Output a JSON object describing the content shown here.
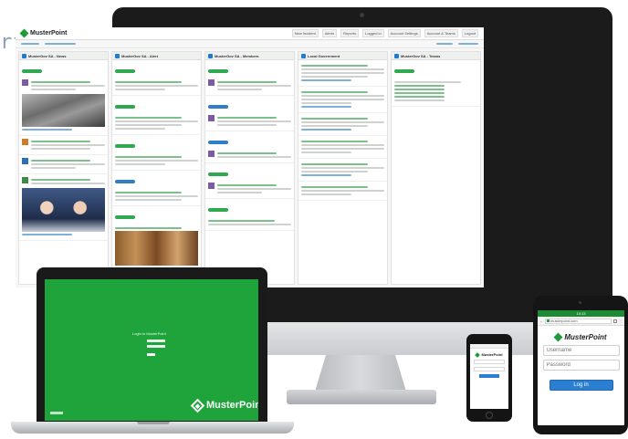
{
  "side_text": "rt",
  "brand": {
    "name": "MusterPoint",
    "accent": "#1f9b3a",
    "link_color": "#2b7fd0"
  },
  "desktop": {
    "logo_text": "MusterPoint",
    "nav": [
      "New Incident",
      "Alerts",
      "Reports",
      "Logged in",
      "Account Settings",
      "Account & Teams",
      "Logout"
    ],
    "columns": [
      {
        "title": "MusterGov SA - News",
        "icon": "twitter-icon"
      },
      {
        "title": "MusterGov SA - Alert",
        "icon": "feed-icon"
      },
      {
        "title": "MusterGov SA - Members",
        "icon": "feed-icon"
      },
      {
        "title": "Local Government",
        "icon": "feed-icon"
      },
      {
        "title": "MusterGov SA - Teams",
        "icon": "feed-icon"
      }
    ]
  },
  "laptop": {
    "login_title": "Login to MusterPoint",
    "logo_text": "MusterPoint"
  },
  "phone": {
    "logo_text": "MusterPoint"
  },
  "tablet": {
    "status_time": "10:13",
    "url": "musterpoint.com",
    "logo_text": "MusterPoint",
    "username_placeholder": "Username",
    "password_placeholder": "Password",
    "login_label": "Log in"
  }
}
